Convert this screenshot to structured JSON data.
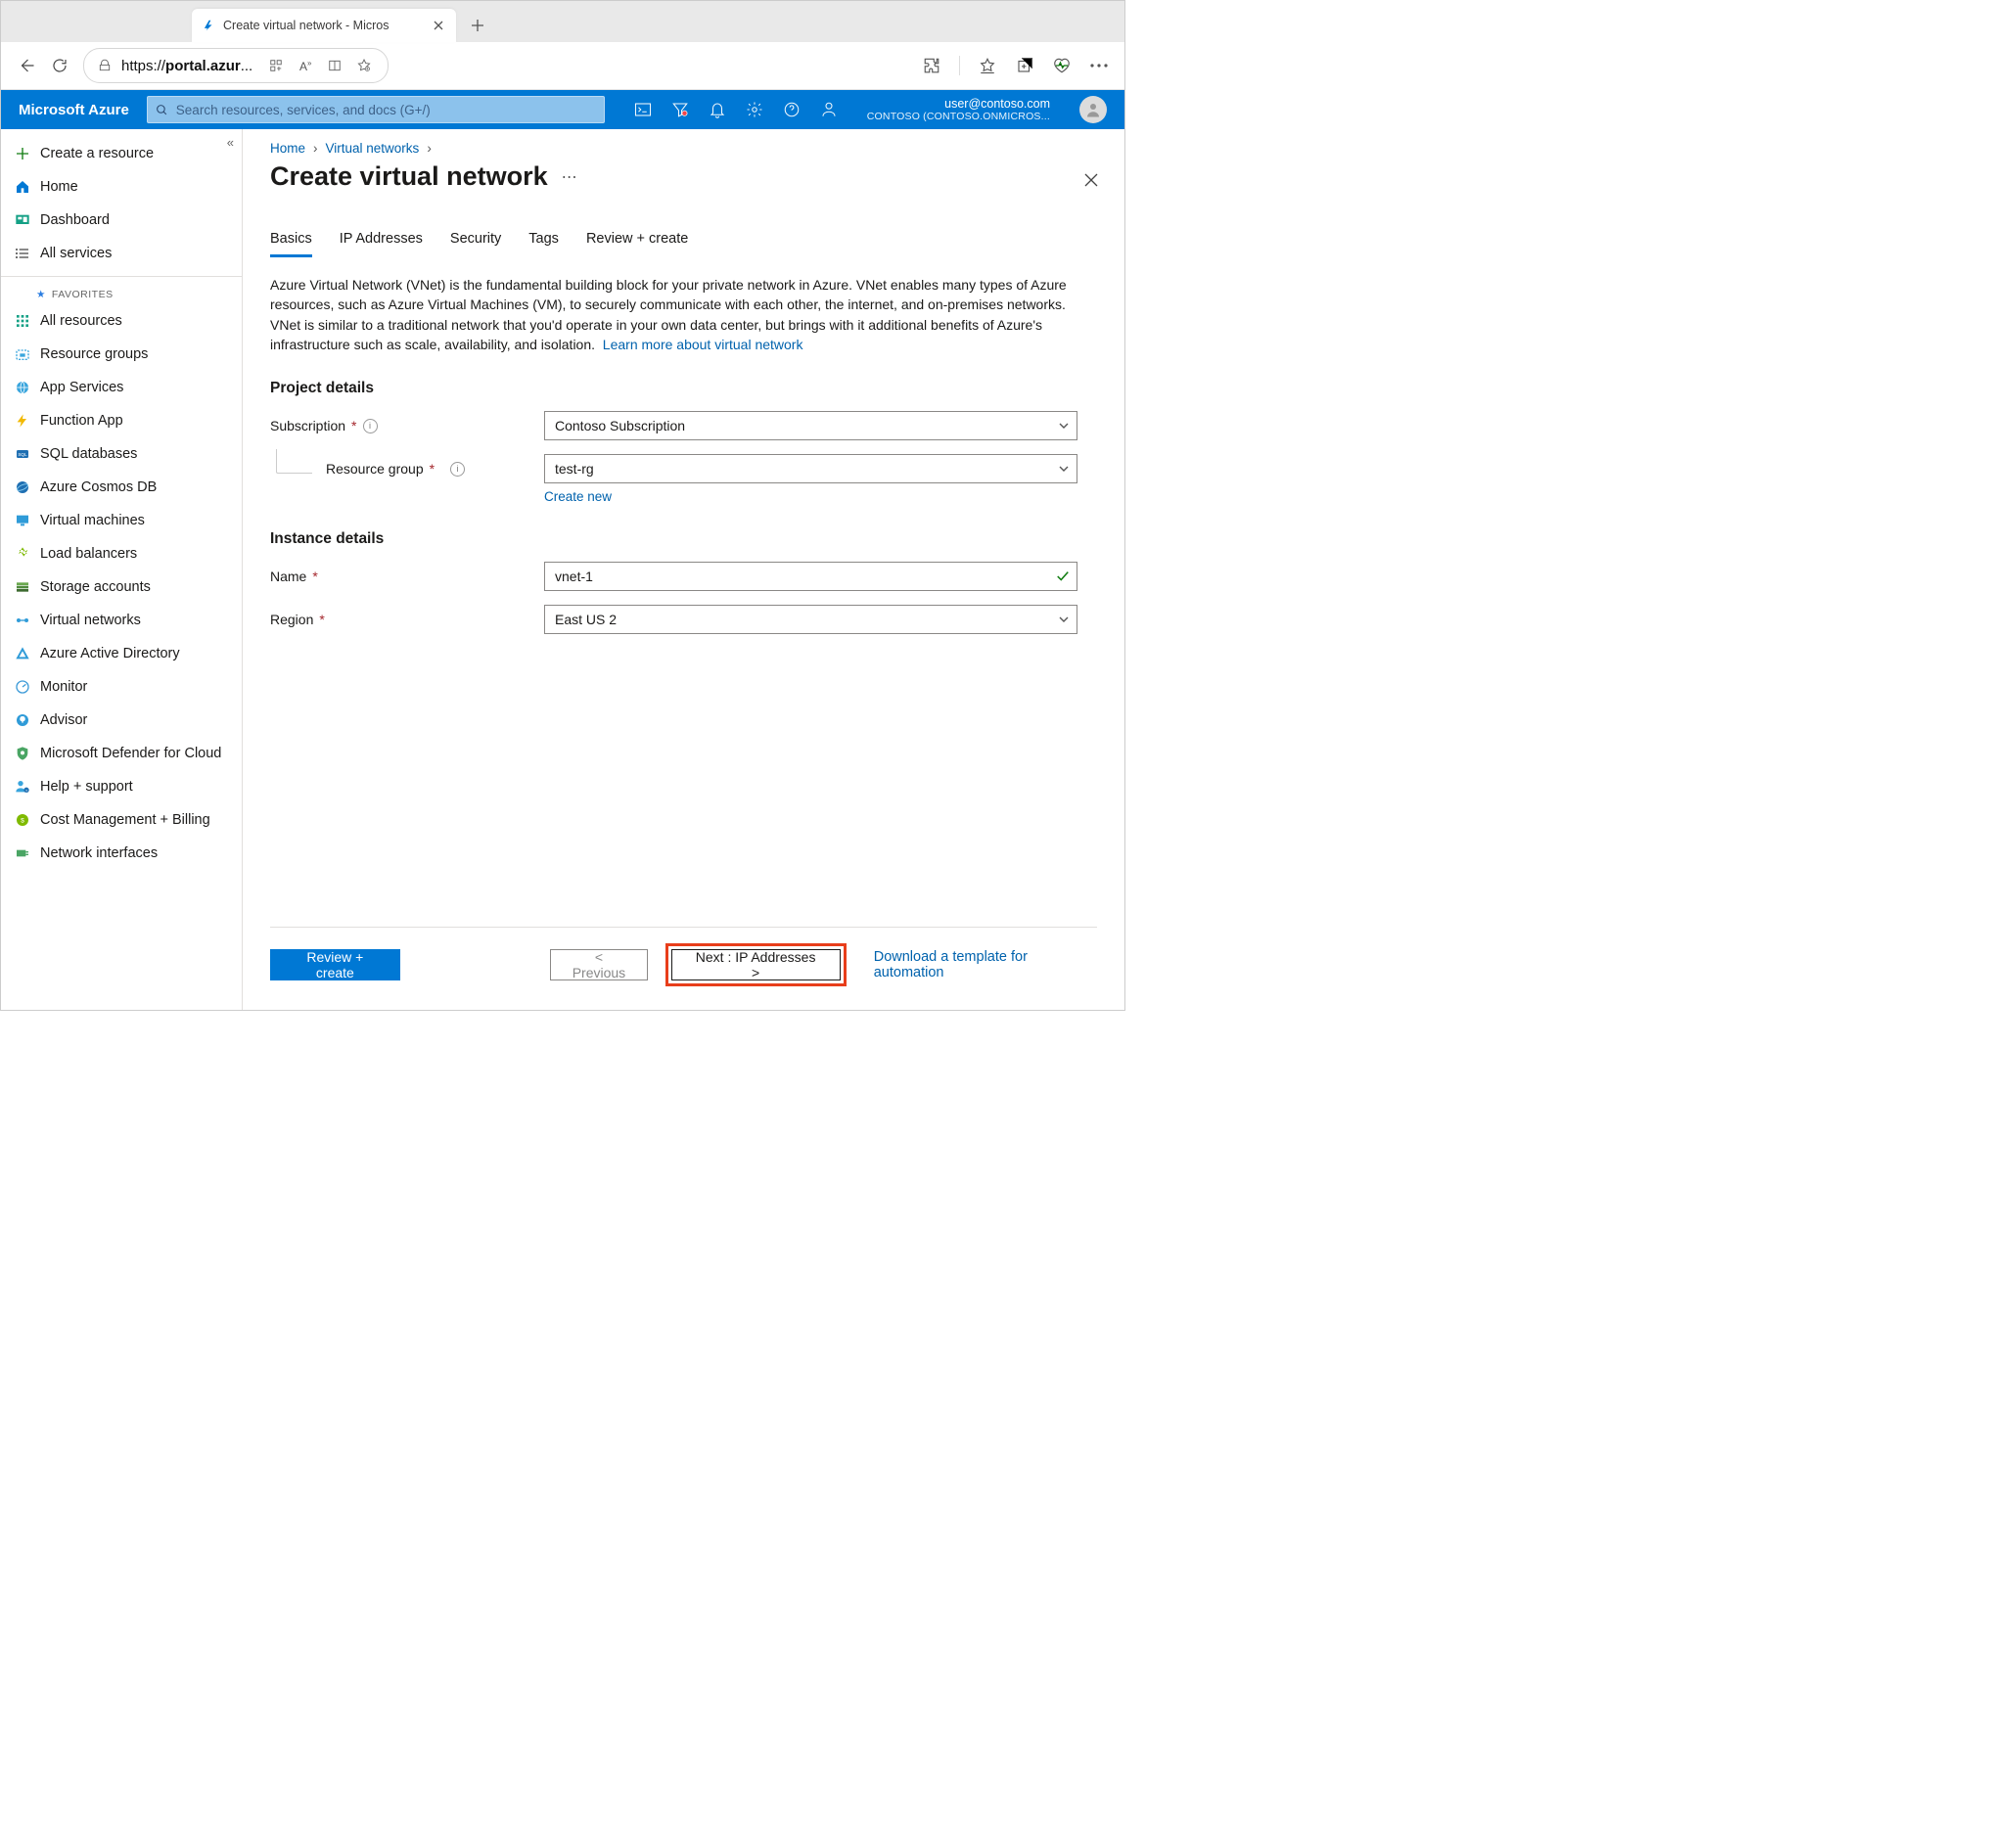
{
  "browser": {
    "tab_title": "Create virtual network - Micros",
    "url_display_pre": "https://",
    "url_host": "portal.azur",
    "url_display_post": "..."
  },
  "shell": {
    "brand": "Microsoft Azure",
    "search_placeholder": "Search resources, services, and docs (G+/)",
    "user_email": "user@contoso.com",
    "tenant": "CONTOSO (CONTOSO.ONMICROS..."
  },
  "sidenav": {
    "top": [
      {
        "icon": "plus",
        "label": "Create a resource"
      },
      {
        "icon": "home",
        "label": "Home"
      },
      {
        "icon": "dashboard",
        "label": "Dashboard"
      },
      {
        "icon": "list",
        "label": "All services"
      }
    ],
    "fav_header": "FAVORITES",
    "favorites": [
      {
        "icon": "grid",
        "label": "All resources"
      },
      {
        "icon": "rg",
        "label": "Resource groups"
      },
      {
        "icon": "globe",
        "label": "App Services"
      },
      {
        "icon": "fn",
        "label": "Function App"
      },
      {
        "icon": "sql",
        "label": "SQL databases"
      },
      {
        "icon": "cosmos",
        "label": "Azure Cosmos DB"
      },
      {
        "icon": "vm",
        "label": "Virtual machines"
      },
      {
        "icon": "lb",
        "label": "Load balancers"
      },
      {
        "icon": "storage",
        "label": "Storage accounts"
      },
      {
        "icon": "vnet",
        "label": "Virtual networks"
      },
      {
        "icon": "aad",
        "label": "Azure Active Directory"
      },
      {
        "icon": "monitor",
        "label": "Monitor"
      },
      {
        "icon": "advisor",
        "label": "Advisor"
      },
      {
        "icon": "defender",
        "label": "Microsoft Defender for Cloud"
      },
      {
        "icon": "help",
        "label": "Help + support"
      },
      {
        "icon": "cost",
        "label": "Cost Management + Billing"
      },
      {
        "icon": "nic",
        "label": "Network interfaces"
      }
    ]
  },
  "breadcrumb": {
    "home": "Home",
    "vnet": "Virtual networks"
  },
  "page_title": "Create virtual network",
  "tabs": [
    "Basics",
    "IP Addresses",
    "Security",
    "Tags",
    "Review + create"
  ],
  "active_tab": "Basics",
  "description": "Azure Virtual Network (VNet) is the fundamental building block for your private network in Azure. VNet enables many types of Azure resources, such as Azure Virtual Machines (VM), to securely communicate with each other, the internet, and on-premises networks. VNet is similar to a traditional network that you'd operate in your own data center, but brings with it additional benefits of Azure's infrastructure such as scale, availability, and isolation.",
  "learn_more": "Learn more about virtual network",
  "section_project": "Project details",
  "section_instance": "Instance details",
  "fields": {
    "subscription": {
      "label": "Subscription",
      "value": "Contoso Subscription",
      "required": true,
      "info": true,
      "type": "select"
    },
    "resource_group": {
      "label": "Resource group",
      "value": "test-rg",
      "required": true,
      "info": true,
      "type": "select",
      "create_new": "Create new"
    },
    "name": {
      "label": "Name",
      "value": "vnet-1",
      "required": true,
      "type": "text",
      "valid": true
    },
    "region": {
      "label": "Region",
      "value": "East US 2",
      "required": true,
      "type": "select"
    }
  },
  "footer": {
    "review": "Review + create",
    "prev": "< Previous",
    "next": "Next : IP Addresses >",
    "download": "Download a template for automation"
  }
}
